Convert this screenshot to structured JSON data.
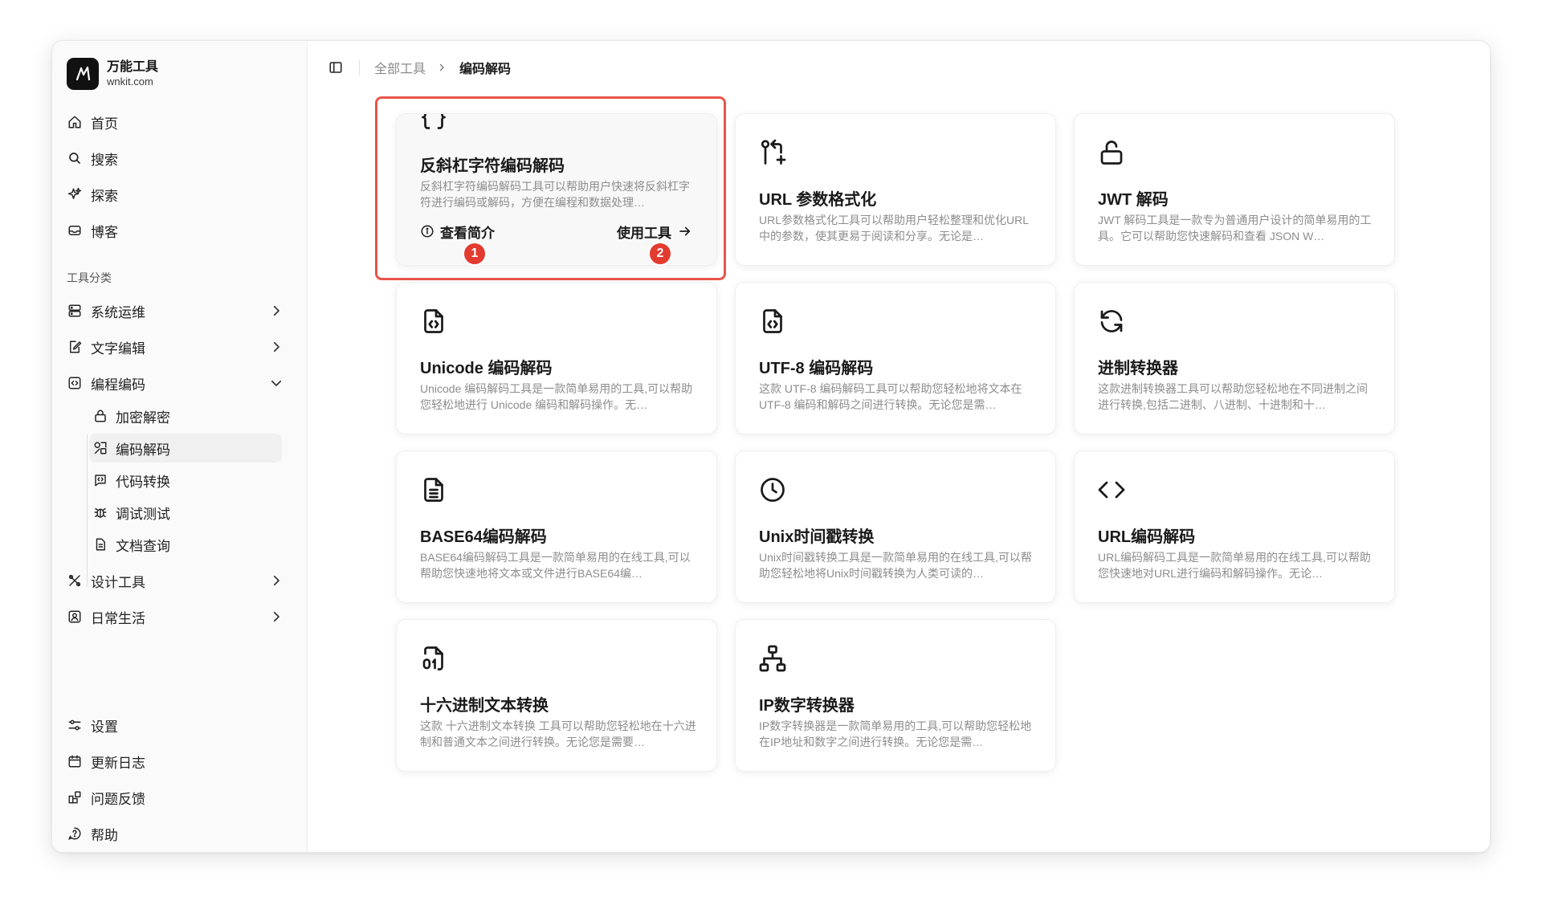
{
  "brand": {
    "name": "万能工具",
    "domain": "wnkit.com"
  },
  "nav": {
    "home": "首页",
    "search": "搜索",
    "explore": "探索",
    "blog": "博客"
  },
  "categories": {
    "label": "工具分类",
    "items": [
      {
        "label": "系统运维",
        "icon": "server-icon",
        "expanded": false
      },
      {
        "label": "文字编辑",
        "icon": "edit-icon",
        "expanded": false
      },
      {
        "label": "编程编码",
        "icon": "code-box-icon",
        "expanded": true
      },
      {
        "label": "设计工具",
        "icon": "design-tools-icon",
        "expanded": false
      },
      {
        "label": "日常生活",
        "icon": "user-box-icon",
        "expanded": false
      }
    ],
    "sub_items": [
      {
        "label": "加密解密",
        "icon": "lock-icon"
      },
      {
        "label": "编码解码",
        "icon": "shapes-icon",
        "active": true
      },
      {
        "label": "代码转换",
        "icon": "code-message-icon"
      },
      {
        "label": "调试测试",
        "icon": "bug-icon"
      },
      {
        "label": "文档查询",
        "icon": "document-icon"
      }
    ]
  },
  "footer_nav": {
    "settings": "设置",
    "changelog": "更新日志",
    "feedback": "问题反馈",
    "help": "帮助"
  },
  "breadcrumb": {
    "root": "全部工具",
    "current": "编码解码"
  },
  "cards": [
    {
      "title": "反斜杠字符编码解码",
      "desc": "反斜杠字符编码解码工具可以帮助用户快速将反斜杠字符进行编码或解码，方便在编程和数据处理…",
      "icon": "braces-icon",
      "hovered": true
    },
    {
      "title": "URL 参数格式化",
      "desc": "URL参数格式化工具可以帮助用户轻松整理和优化URL中的参数，使其更易于阅读和分享。无论是…",
      "icon": "git-pull-request-icon"
    },
    {
      "title": "JWT 解码",
      "desc": "JWT 解码工具是一款专为普通用户设计的简单易用的工具。它可以帮助您快速解码和查看 JSON W…",
      "icon": "unlock-icon"
    },
    {
      "title": "Unicode 编码解码",
      "desc": "Unicode 编码解码工具是一款简单易用的工具,可以帮助您轻松地进行 Unicode 编码和解码操作。无…",
      "icon": "file-code-icon"
    },
    {
      "title": "UTF-8 编码解码",
      "desc": "这款 UTF-8 编码解码工具可以帮助您轻松地将文本在 UTF-8 编码和解码之间进行转换。无论您是需…",
      "icon": "file-code-icon"
    },
    {
      "title": "进制转换器",
      "desc": "这款进制转换器工具可以帮助您轻松地在不同进制之间进行转换,包括二进制、八进制、十进制和十…",
      "icon": "refresh-icon"
    },
    {
      "title": "BASE64编码解码",
      "desc": "BASE64编码解码工具是一款简单易用的在线工具,可以帮助您快速地将文本或文件进行BASE64编…",
      "icon": "file-text-icon"
    },
    {
      "title": "Unix时间戳转换",
      "desc": "Unix时间戳转换工具是一款简单易用的在线工具,可以帮助您轻松地将Unix时间戳转换为人类可读的…",
      "icon": "clock-icon"
    },
    {
      "title": "URL编码解码",
      "desc": "URL编码解码工具是一款简单易用的在线工具,可以帮助您快速地对URL进行编码和解码操作。无论…",
      "icon": "code-icon"
    },
    {
      "title": "十六进制文本转换",
      "desc": "这款 十六进制文本转换 工具可以帮助您轻松地在十六进制和普通文本之间进行转换。无论您是需要…",
      "icon": "file-binary-icon"
    },
    {
      "title": "IP数字转换器",
      "desc": "IP数字转换器是一款简单易用的工具,可以帮助您轻松地在IP地址和数字之间进行转换。无论您是需…",
      "icon": "network-icon"
    }
  ],
  "card_actions": {
    "info_label": "查看简介",
    "use_label": "使用工具"
  },
  "annotations": {
    "badge_1": "1",
    "badge_2": "2",
    "highlight_color": "#e8554b",
    "badge_color": "#e23b30"
  }
}
